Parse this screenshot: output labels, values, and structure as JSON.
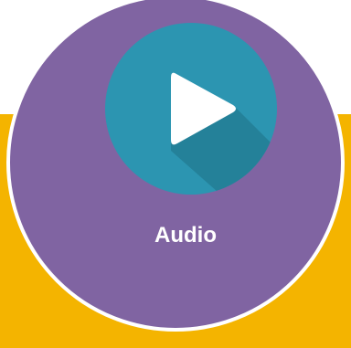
{
  "tile": {
    "label": "Audio",
    "icon": "play-icon"
  },
  "colors": {
    "background": "#ffffff",
    "band": "#f4b400",
    "circle": "#8064a2",
    "circle_border": "#ffffff",
    "icon_circle": "#2c95b1",
    "icon_shadow": "#237c94",
    "icon_glyph": "#ffffff"
  }
}
